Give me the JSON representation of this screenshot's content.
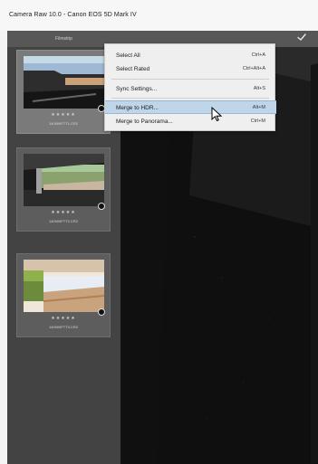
{
  "window": {
    "title": "Camera Raw 10.0 - Canon EOS 5D Mark IV"
  },
  "filmstrip": {
    "header_label": "Filmstrip",
    "thumbnails": [
      {
        "stars": "★★★★★",
        "label": "140909FTT1.CR2",
        "selected": true
      },
      {
        "stars": "★★★★★",
        "label": "140909FTT2.CR2",
        "selected": false
      },
      {
        "stars": "★★★★★",
        "label": "140909FTT3.CR2",
        "selected": false
      }
    ]
  },
  "menu": {
    "items": [
      {
        "label": "Select All",
        "shortcut": "Ctrl+A"
      },
      {
        "label": "Select Rated",
        "shortcut": "Ctrl+Alt+A"
      },
      {
        "label": "Sync Settings...",
        "shortcut": "Alt+S"
      },
      {
        "label": "Merge to HDR...",
        "shortcut": "Alt+M",
        "highlighted": true
      },
      {
        "label": "Merge to Panorama...",
        "shortcut": "Ctrl+M"
      }
    ]
  },
  "toolbar": {
    "left_text": "",
    "right_text": ""
  },
  "colors": {
    "panel": "#434343",
    "selected_card": "#7a7a7a",
    "menu_bg": "#efefef",
    "menu_highlight": "#bfd5ea"
  },
  "icons": {
    "check": "check-icon",
    "cursor": "mouse-pointer-icon",
    "badge": "edit-badge-icon"
  }
}
